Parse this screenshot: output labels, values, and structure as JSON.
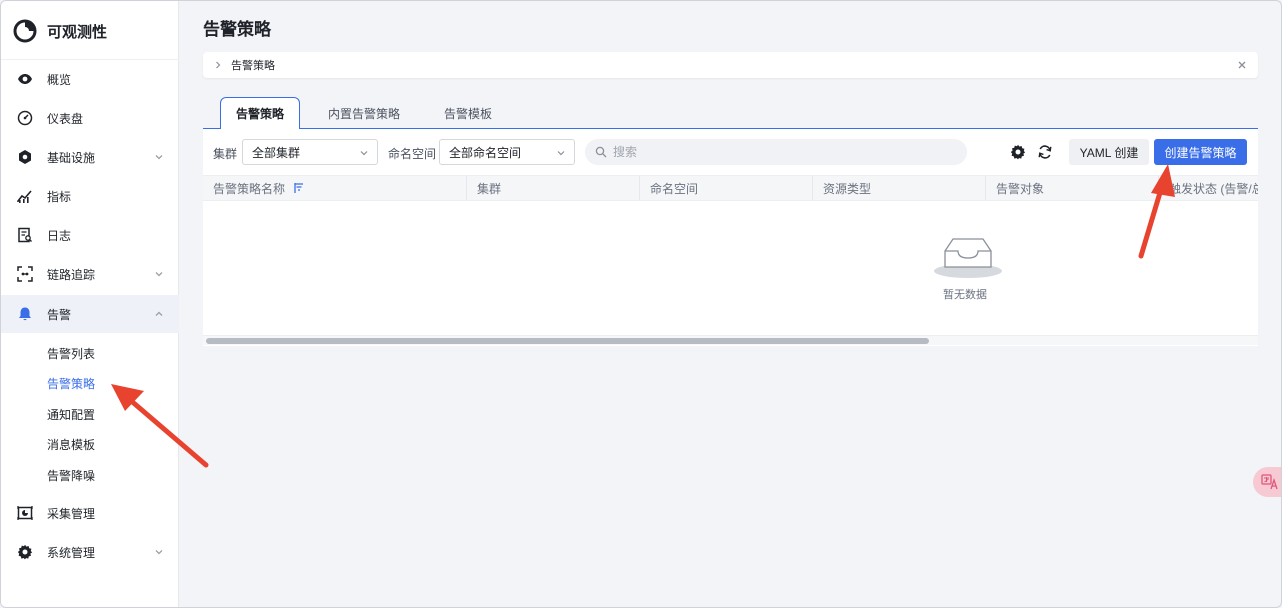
{
  "app": {
    "title": "可观测性"
  },
  "sidebar": {
    "items": [
      {
        "label": "概览",
        "icon": "eye-icon",
        "expandable": false
      },
      {
        "label": "仪表盘",
        "icon": "gauge-icon",
        "expandable": false
      },
      {
        "label": "基础设施",
        "icon": "cube-icon",
        "expandable": true
      },
      {
        "label": "指标",
        "icon": "metrics-chart-icon",
        "expandable": false
      },
      {
        "label": "日志",
        "icon": "log-search-icon",
        "expandable": false
      },
      {
        "label": "链路追踪",
        "icon": "trace-scan-icon",
        "expandable": true
      },
      {
        "label": "告警",
        "icon": "bell-icon",
        "expandable": true,
        "expanded": true,
        "active": true
      },
      {
        "label": "采集管理",
        "icon": "collect-icon",
        "expandable": false
      },
      {
        "label": "系统管理",
        "icon": "gear-icon",
        "expandable": true
      }
    ],
    "alert_children": [
      {
        "label": "告警列表"
      },
      {
        "label": "告警策略",
        "current": true
      },
      {
        "label": "通知配置"
      },
      {
        "label": "消息模板"
      },
      {
        "label": "告警降噪"
      }
    ]
  },
  "header": {
    "title": "告警策略"
  },
  "breadcrumb": {
    "current": "告警策略"
  },
  "tabs": [
    {
      "label": "告警策略",
      "active": true
    },
    {
      "label": "内置告警策略"
    },
    {
      "label": "告警模板"
    }
  ],
  "filters": {
    "cluster_label": "集群",
    "cluster_value": "全部集群",
    "namespace_label": "命名空间",
    "namespace_value": "全部命名空间",
    "search_placeholder": "搜索"
  },
  "actions": {
    "yaml_create": "YAML 创建",
    "create_policy": "创建告警策略"
  },
  "table": {
    "columns": [
      "告警策略名称",
      "集群",
      "命名空间",
      "资源类型",
      "告警对象",
      "触发状态 (告警/总"
    ],
    "rows": [],
    "empty_text": "暂无数据"
  },
  "colors": {
    "accent": "#3a6ee8",
    "annotation_arrow": "#e8432f"
  }
}
